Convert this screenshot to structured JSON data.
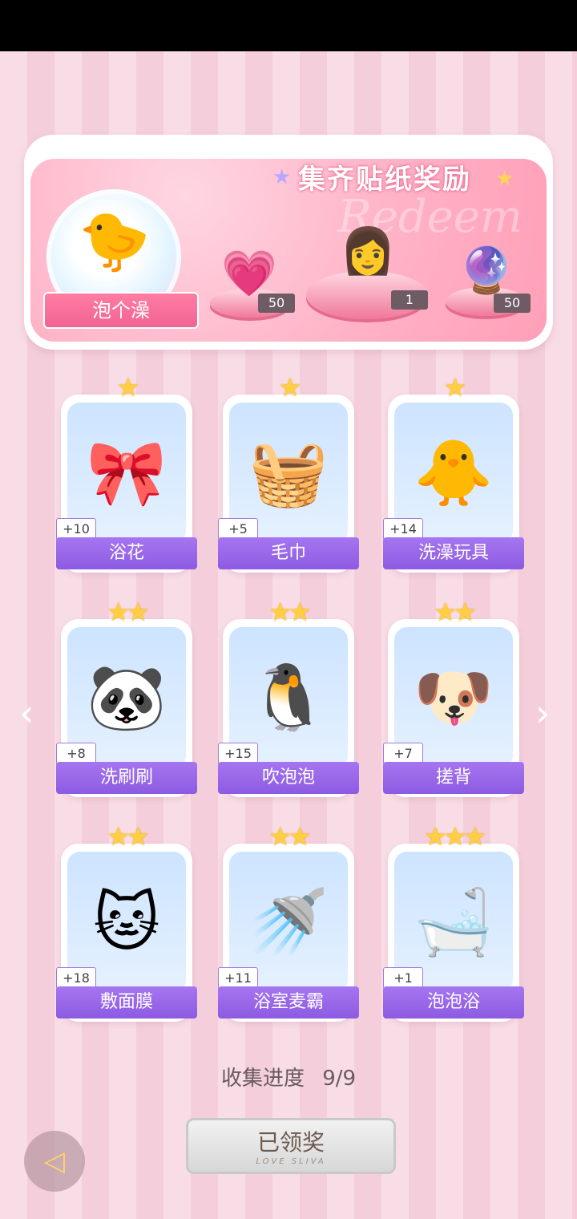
{
  "reward_panel": {
    "title": "集齐贴纸奖励",
    "watermark": "Redeem",
    "set_name": "泡个澡",
    "rewards": [
      {
        "icon": "heart-gem-icon",
        "count": "50"
      },
      {
        "icon": "outfit-portrait-icon",
        "count": "1"
      },
      {
        "icon": "energy-orb-icon",
        "count": "50"
      }
    ]
  },
  "stickers": [
    {
      "name": "浴花",
      "bonus": "+10",
      "stars": "★"
    },
    {
      "name": "毛巾",
      "bonus": "+5",
      "stars": "★"
    },
    {
      "name": "洗澡玩具",
      "bonus": "+14",
      "stars": "★"
    },
    {
      "name": "洗刷刷",
      "bonus": "+8",
      "stars": "★★"
    },
    {
      "name": "吹泡泡",
      "bonus": "+15",
      "stars": "★★"
    },
    {
      "name": "搓背",
      "bonus": "+7",
      "stars": "★★"
    },
    {
      "name": "敷面膜",
      "bonus": "+18",
      "stars": "★★"
    },
    {
      "name": "浴室麦霸",
      "bonus": "+11",
      "stars": "★★"
    },
    {
      "name": "泡泡浴",
      "bonus": "+1",
      "stars": "★★★"
    }
  ],
  "progress": {
    "label": "收集进度",
    "value": "9/9"
  },
  "claim_button": {
    "label": "已领奖",
    "subtitle": "LOVE SLIVA"
  },
  "nav": {
    "prev": "‹",
    "next": "›"
  },
  "back_button": {
    "icon": "back-arrow-icon"
  }
}
